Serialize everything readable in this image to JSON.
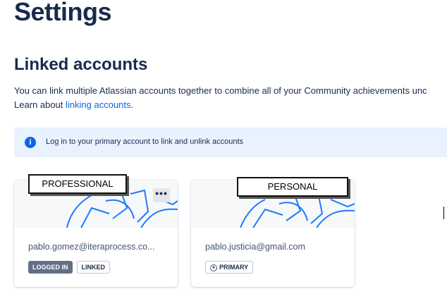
{
  "page": {
    "title": "Settings"
  },
  "linked_accounts": {
    "heading": "Linked accounts",
    "description": "You can link multiple Atlassian accounts together to combine all of your Community achievements unc",
    "learn_prefix": "Learn about ",
    "learn_link": "linking accounts",
    "learn_suffix": ".",
    "banner": {
      "icon": "info-icon",
      "icon_glyph": "i",
      "text": "Log in to your primary account to link and unlink accounts"
    },
    "accounts": [
      {
        "annotation": "PROFESSIONAL",
        "email": "pablo.gomez@iteraprocess.co...",
        "badges": [
          "LOGGED IN",
          "LINKED"
        ],
        "more_glyph": "•••"
      },
      {
        "annotation": "PERSONAL",
        "email": "pablo.justicia@gmail.com",
        "badges": [
          "PRIMARY"
        ],
        "primary_icon": "star-circle-icon"
      }
    ]
  },
  "colors": {
    "heading": "#172b4d",
    "link": "#0c66e4",
    "banner_bg": "#e9f2ff",
    "badge_solid": "#626f86",
    "pattern_stroke": "#1d7afc"
  }
}
